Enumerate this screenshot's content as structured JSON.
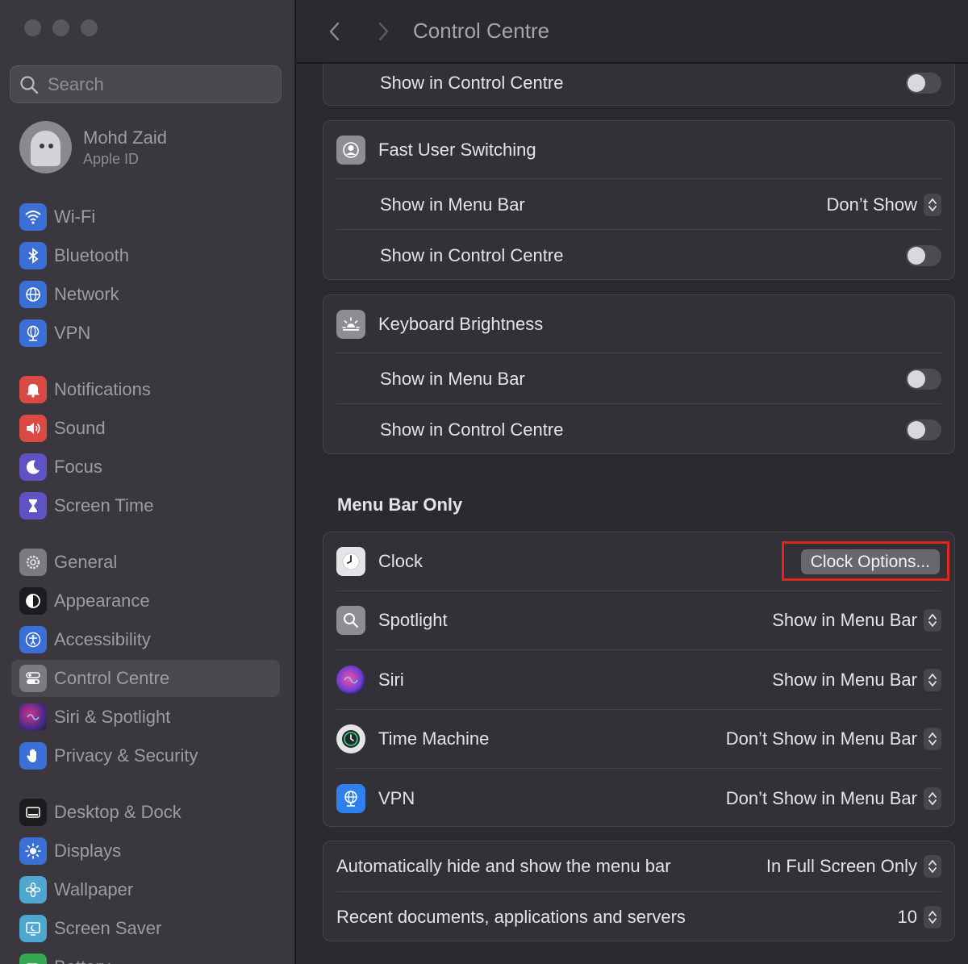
{
  "window": {
    "title": "Control Centre"
  },
  "search": {
    "placeholder": "Search"
  },
  "profile": {
    "name": "Mohd Zaid",
    "subtitle": "Apple ID"
  },
  "sidebar": {
    "items": [
      {
        "label": "Wi-Fi",
        "icon": "wifi-icon",
        "color": "#3b82f6"
      },
      {
        "label": "Bluetooth",
        "icon": "bluetooth-icon",
        "color": "#3b82f6"
      },
      {
        "label": "Network",
        "icon": "globe-icon",
        "color": "#3b82f6"
      },
      {
        "label": "VPN",
        "icon": "vpn-globe-icon",
        "color": "#3b82f6"
      },
      {
        "label": "Notifications",
        "icon": "bell-icon",
        "color": "#e0514d"
      },
      {
        "label": "Sound",
        "icon": "speaker-icon",
        "color": "#e0514d"
      },
      {
        "label": "Focus",
        "icon": "moon-icon",
        "color": "#6a5acd"
      },
      {
        "label": "Screen Time",
        "icon": "hourglass-icon",
        "color": "#6a5acd"
      },
      {
        "label": "General",
        "icon": "gear-icon",
        "color": "#8e8e93"
      },
      {
        "label": "Appearance",
        "icon": "appearance-icon",
        "color": "#1c1c1e"
      },
      {
        "label": "Accessibility",
        "icon": "accessibility-icon",
        "color": "#3b82f6"
      },
      {
        "label": "Control Centre",
        "icon": "control-centre-icon",
        "color": "#8e8e93"
      },
      {
        "label": "Siri & Spotlight",
        "icon": "siri-icon",
        "color": "#8e44ad"
      },
      {
        "label": "Privacy & Security",
        "icon": "hand-icon",
        "color": "#3b82f6"
      },
      {
        "label": "Desktop & Dock",
        "icon": "dock-icon",
        "color": "#1c1c1e"
      },
      {
        "label": "Displays",
        "icon": "sun-icon",
        "color": "#3b82f6"
      },
      {
        "label": "Wallpaper",
        "icon": "flower-icon",
        "color": "#4aa3c7"
      },
      {
        "label": "Screen Saver",
        "icon": "screen-saver-icon",
        "color": "#4aa3c7"
      },
      {
        "label": "Battery",
        "icon": "battery-icon",
        "color": "#34c759"
      }
    ]
  },
  "main": {
    "top_card": {
      "row_label": "Show in Control Centre"
    },
    "fast_user_switching": {
      "title": "Fast User Switching",
      "rows": [
        {
          "label": "Show in Menu Bar",
          "value": "Don’t Show"
        },
        {
          "label": "Show in Control Centre"
        }
      ]
    },
    "keyboard_brightness": {
      "title": "Keyboard Brightness",
      "rows": [
        {
          "label": "Show in Menu Bar"
        },
        {
          "label": "Show in Control Centre"
        }
      ]
    },
    "menu_bar_only": {
      "section_title": "Menu Bar Only",
      "clock": {
        "label": "Clock",
        "button": "Clock Options..."
      },
      "items": [
        {
          "label": "Spotlight",
          "value": "Show in Menu Bar"
        },
        {
          "label": "Siri",
          "value": "Show in Menu Bar"
        },
        {
          "label": "Time Machine",
          "value": "Don’t Show in Menu Bar"
        },
        {
          "label": "VPN",
          "value": "Don’t Show in Menu Bar"
        }
      ]
    },
    "menu_bar_settings": {
      "rows": [
        {
          "label": "Automatically hide and show the menu bar",
          "value": "In Full Screen Only"
        },
        {
          "label": "Recent documents, applications and servers",
          "value": "10"
        }
      ]
    }
  }
}
